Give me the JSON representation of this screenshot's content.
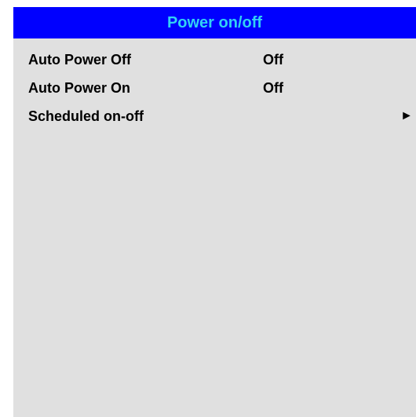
{
  "menu": {
    "title": "Power on/off",
    "colors": {
      "header_bg": "#0000ff",
      "header_text": "#32d2f4",
      "panel_bg": "#e0e0e0",
      "item_text": "#000000"
    },
    "items": [
      {
        "label": "Auto Power Off",
        "value": "Off"
      },
      {
        "label": "Auto Power On",
        "value": "Off"
      },
      {
        "label": "Scheduled on-off",
        "submenu_icon": "right-triangle-icon",
        "submenu_glyph": "►"
      }
    ]
  }
}
